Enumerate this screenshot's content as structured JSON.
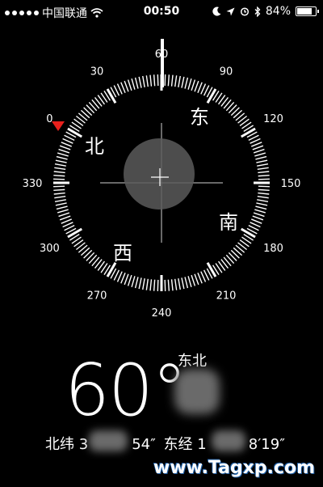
{
  "status_bar": {
    "carrier": "中国联通",
    "time": "00:50",
    "battery": "84%",
    "battery_level": 0.84
  },
  "compass": {
    "heading": 60,
    "cardinals": {
      "north": "北",
      "east": "东",
      "south": "南",
      "west": "西"
    },
    "degree_labels": [
      "0",
      "30",
      "60",
      "90",
      "120",
      "150",
      "180",
      "210",
      "240",
      "270",
      "300",
      "330"
    ],
    "marker_color": "#e8201c"
  },
  "readout": {
    "heading_text": "60°",
    "direction_text": "东北",
    "coords": {
      "lat_label": "北纬 3",
      "lat_tail": "54″",
      "lon_label": "东经 1",
      "lon_tail": "8′19″"
    }
  },
  "watermark": "www.Tagxp.com"
}
